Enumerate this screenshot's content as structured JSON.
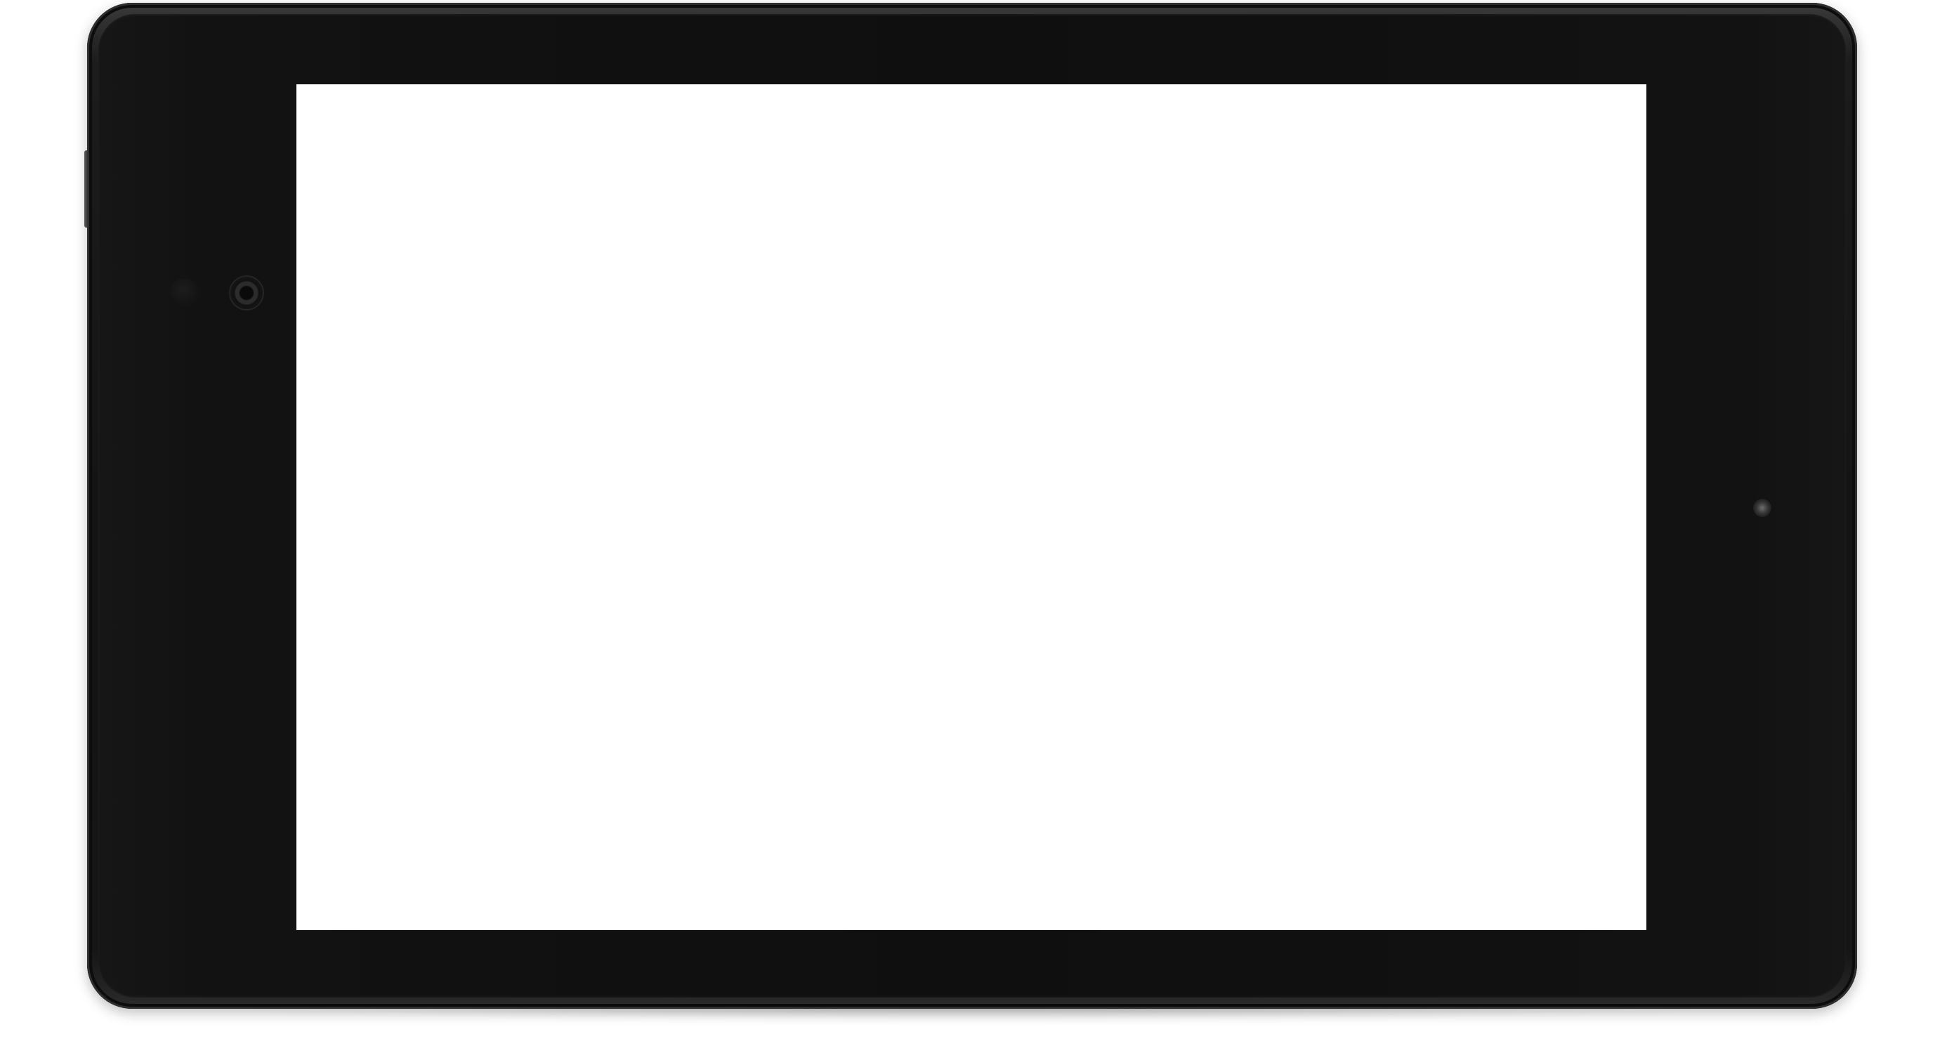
{
  "device": {
    "type": "tablet",
    "orientation": "landscape",
    "frame_color": "#141414",
    "screen_color": "#ffffff"
  },
  "icons": {
    "camera": "camera-icon",
    "sensor": "light-sensor-icon",
    "led": "notification-led-icon"
  }
}
